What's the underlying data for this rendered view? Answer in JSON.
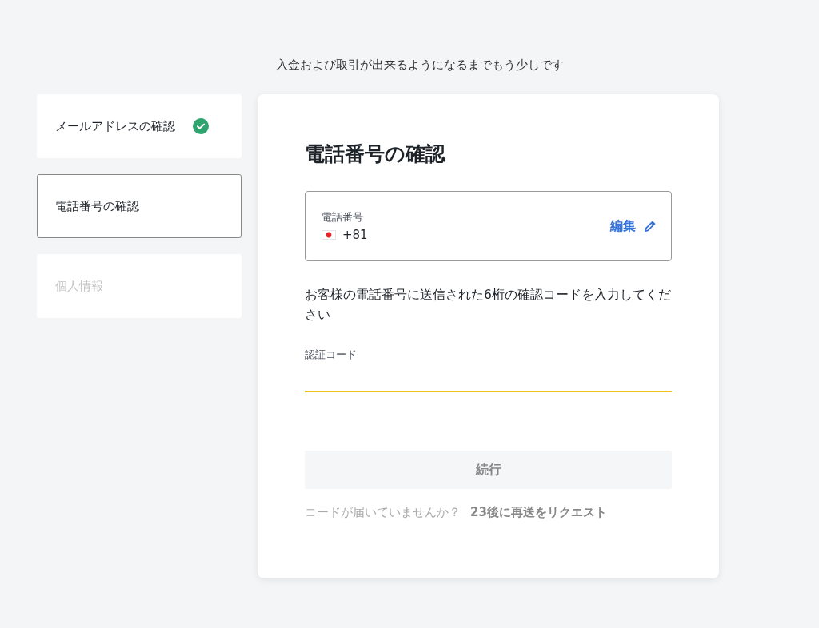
{
  "header": {
    "text": "入金および取引が出来るようになるまでもう少しです"
  },
  "steps": [
    {
      "label": "メールアドレスの確認",
      "completed": true,
      "selected": false,
      "disabled": false
    },
    {
      "label": "電話番号の確認",
      "completed": false,
      "selected": true,
      "disabled": false
    },
    {
      "label": "個人情報",
      "completed": false,
      "selected": false,
      "disabled": true
    }
  ],
  "card": {
    "title": "電話番号の確認",
    "phone": {
      "label": "電話番号",
      "value": "+81",
      "edit": "編集"
    },
    "instructions": "お客様の電話番号に送信された6桁の確認コードを入力してください",
    "code_field": {
      "label": "認証コード"
    },
    "continue_button": {
      "label": "続行",
      "disabled": true
    },
    "resend": {
      "prompt": "コードが届いていませんか？",
      "link": "23後に再送をリクエスト"
    }
  }
}
